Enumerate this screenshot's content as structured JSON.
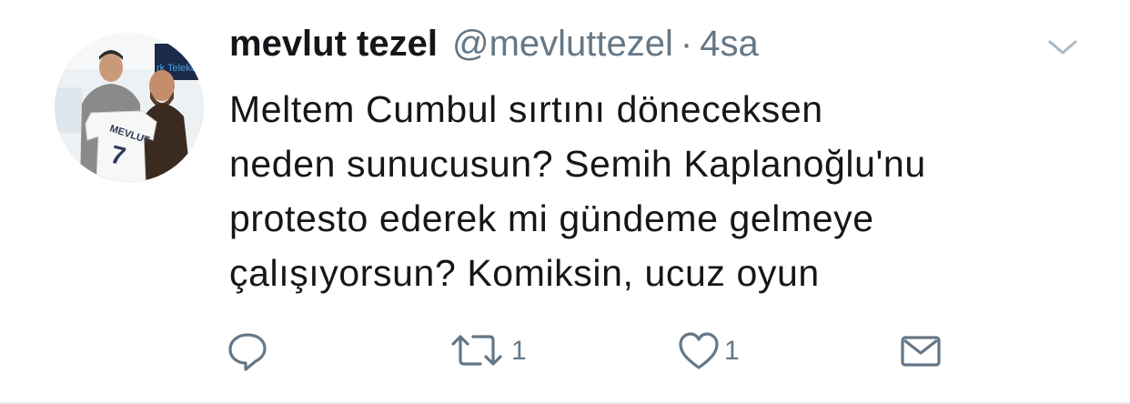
{
  "tweet": {
    "author": {
      "name": "mevlut tezel",
      "handle": "@mevluttezel",
      "separator": "·",
      "time": "4sa"
    },
    "text_lines": [
      "Meltem Cumbul sırtını döneceksen",
      "neden sunucusun? Semih Kaplanoğlu'nu",
      "protesto ederek mi gündeme gelmeye",
      "çalışıyorsun? Komiksin, ucuz oyun"
    ],
    "actions": {
      "reply_count": "",
      "retweet_count": "1",
      "like_count": "1"
    },
    "avatar_jersey_text": "MEVLUT",
    "avatar_jersey_number": "7"
  },
  "icons": {
    "menu": "chevron-down-icon",
    "reply": "reply-icon",
    "retweet": "retweet-icon",
    "like": "heart-icon",
    "dm": "envelope-icon"
  },
  "colors": {
    "text": "#14171a",
    "secondary": "#657786",
    "icon": "#657786",
    "divider": "#e6ecf0"
  }
}
